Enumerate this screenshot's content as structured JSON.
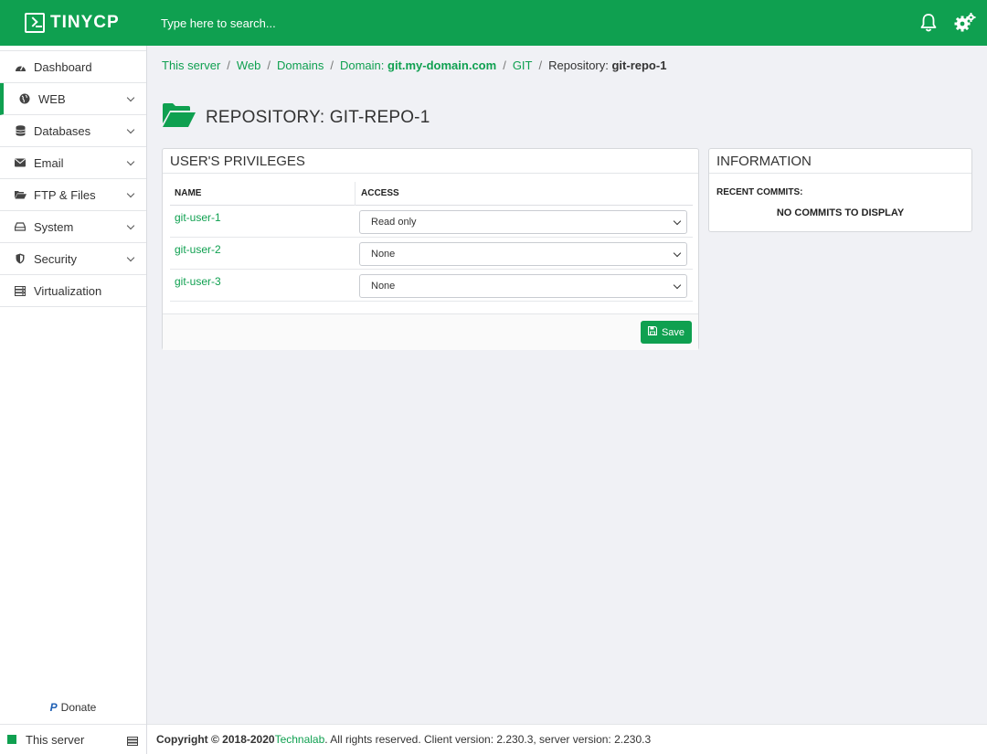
{
  "app": {
    "logo_text": "TINYCP"
  },
  "topbar": {
    "search_placeholder": "Type here to search..."
  },
  "sidebar": {
    "items": [
      {
        "label": "Dashboard",
        "icon": "dashboard-icon"
      },
      {
        "label": "WEB",
        "icon": "globe-icon"
      },
      {
        "label": "Databases",
        "icon": "database-icon"
      },
      {
        "label": "Email",
        "icon": "envelope-icon"
      },
      {
        "label": "FTP & Files",
        "icon": "folder-open-icon"
      },
      {
        "label": "System",
        "icon": "drive-icon"
      },
      {
        "label": "Security",
        "icon": "shield-icon"
      },
      {
        "label": "Virtualization",
        "icon": "server-icon"
      }
    ],
    "donate": "Donate",
    "server": "This server"
  },
  "breadcrumb": {
    "items": [
      "This server",
      "Web",
      "Domains",
      "Domain: ",
      "git.my-domain.com",
      "GIT"
    ],
    "current_prefix": "Repository: ",
    "current": "git-repo-1"
  },
  "page": {
    "title": "REPOSITORY: GIT-REPO-1"
  },
  "privileges": {
    "title": "USER'S PRIVILEGES",
    "columns": [
      "NAME",
      "ACCESS"
    ],
    "rows": [
      {
        "name": "git-user-1",
        "access": "Read only"
      },
      {
        "name": "git-user-2",
        "access": "None"
      },
      {
        "name": "git-user-3",
        "access": "None"
      }
    ],
    "save_label": "Save"
  },
  "information": {
    "title": "INFORMATION",
    "recent_label": "RECENT COMMITS:",
    "empty": "NO COMMITS TO DISPLAY"
  },
  "footer": {
    "copyright": "Copyright © 2018-2020 ",
    "company": "Technalab",
    "rest": ". All rights reserved. Client version: 2.230.3, server version: 2.230.3"
  },
  "colors": {
    "accent": "#0fa050",
    "background": "#f0f1f5"
  }
}
